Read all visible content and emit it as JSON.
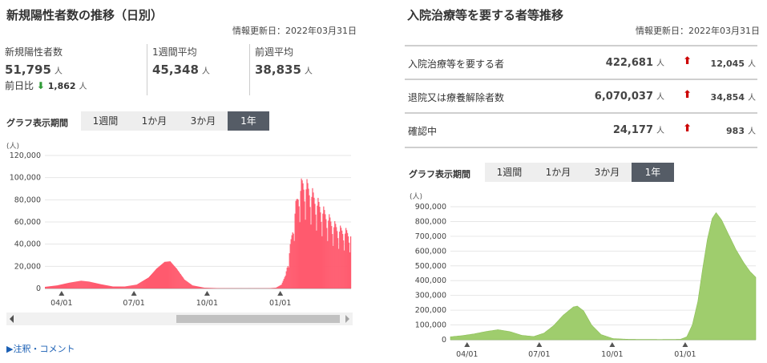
{
  "left": {
    "title": "新規陽性者数の推移（日別）",
    "updated": "情報更新日：2022年03月31日",
    "stats": [
      {
        "label": "新規陽性者数",
        "value": "51,795",
        "unit": "人"
      },
      {
        "label": "1週間平均",
        "value": "45,348",
        "unit": "人"
      },
      {
        "label": "前週平均",
        "value": "38,835",
        "unit": "人"
      }
    ],
    "prev_day": {
      "label": "前日比",
      "arrow": "⬇",
      "value": "1,862",
      "unit": "人",
      "arrow_color": "#2e9a35"
    },
    "period_label": "グラフ表示期間",
    "periods": [
      "1週間",
      "1か月",
      "3か月",
      "1年"
    ],
    "active_period": "1年",
    "note_link": "▶注釈・コメント"
  },
  "right": {
    "title": "入院治療等を要する者等推移",
    "updated": "情報更新日：2022年03月31日",
    "rows": [
      {
        "label": "入院治療等を要する者",
        "value": "422,681",
        "unit": "人",
        "arrow": "⬆",
        "delta": "12,045",
        "delta_unit": "人"
      },
      {
        "label": "退院又は療養解除者数",
        "value": "6,070,037",
        "unit": "人",
        "arrow": "⬆",
        "delta": "34,854",
        "delta_unit": "人"
      },
      {
        "label": "確認中",
        "value": "24,177",
        "unit": "人",
        "arrow": "⬆",
        "delta": "983",
        "delta_unit": "人"
      }
    ],
    "period_label": "グラフ表示期間",
    "periods": [
      "1週間",
      "1か月",
      "3か月",
      "1年"
    ],
    "active_period": "1年"
  },
  "chart_data": [
    {
      "type": "bar",
      "color": "#ff5a6e",
      "unit_label": "(人)",
      "ylim": [
        0,
        120000
      ],
      "yticks": [
        0,
        20000,
        40000,
        60000,
        80000,
        100000,
        120000
      ],
      "ytick_labels": [
        "0",
        "20,000",
        "40,000",
        "60,000",
        "80,000",
        "100,000",
        "120,000"
      ],
      "xtick_labels": [
        "04/01",
        "07/01",
        "10/01",
        "01/01"
      ],
      "xtick_days": [
        21,
        112,
        204,
        296
      ],
      "days": 385,
      "envelope": [
        [
          0,
          1500
        ],
        [
          15,
          2800
        ],
        [
          30,
          5200
        ],
        [
          45,
          7000
        ],
        [
          55,
          6200
        ],
        [
          70,
          3800
        ],
        [
          85,
          1800
        ],
        [
          100,
          1800
        ],
        [
          115,
          3500
        ],
        [
          130,
          10000
        ],
        [
          140,
          18000
        ],
        [
          150,
          24000
        ],
        [
          157,
          24500
        ],
        [
          165,
          18000
        ],
        [
          175,
          8000
        ],
        [
          185,
          2800
        ],
        [
          200,
          700
        ],
        [
          220,
          250
        ],
        [
          250,
          150
        ],
        [
          280,
          200
        ],
        [
          290,
          700
        ],
        [
          297,
          3500
        ],
        [
          302,
          12000
        ],
        [
          308,
          40000
        ],
        [
          314,
          75000
        ],
        [
          319,
          95000
        ],
        [
          324,
          102000
        ],
        [
          330,
          98000
        ],
        [
          338,
          88000
        ],
        [
          346,
          78000
        ],
        [
          354,
          70000
        ],
        [
          362,
          62000
        ],
        [
          370,
          57000
        ],
        [
          377,
          55000
        ],
        [
          385,
          51795
        ]
      ]
    },
    {
      "type": "area",
      "color": "#9fcd6d",
      "unit_label": "(人)",
      "ylim": [
        0,
        900000
      ],
      "yticks": [
        0,
        100000,
        200000,
        300000,
        400000,
        500000,
        600000,
        700000,
        800000,
        900000
      ],
      "ytick_labels": [
        "0",
        "100,000",
        "200,000",
        "300,000",
        "400,000",
        "500,000",
        "600,000",
        "700,000",
        "800,000",
        "900,000"
      ],
      "xtick_labels": [
        "04/01",
        "07/01",
        "10/01",
        "01/01"
      ],
      "xtick_days": [
        21,
        112,
        204,
        296
      ],
      "days": 385,
      "envelope": [
        [
          0,
          20000
        ],
        [
          15,
          28000
        ],
        [
          30,
          40000
        ],
        [
          45,
          56000
        ],
        [
          60,
          68000
        ],
        [
          75,
          55000
        ],
        [
          90,
          30000
        ],
        [
          105,
          22000
        ],
        [
          118,
          45000
        ],
        [
          130,
          95000
        ],
        [
          142,
          165000
        ],
        [
          155,
          222000
        ],
        [
          160,
          228000
        ],
        [
          168,
          195000
        ],
        [
          178,
          100000
        ],
        [
          190,
          35000
        ],
        [
          205,
          8000
        ],
        [
          225,
          3000
        ],
        [
          265,
          2000
        ],
        [
          290,
          3000
        ],
        [
          298,
          20000
        ],
        [
          305,
          100000
        ],
        [
          312,
          260000
        ],
        [
          318,
          480000
        ],
        [
          324,
          680000
        ],
        [
          330,
          820000
        ],
        [
          335,
          860000
        ],
        [
          342,
          810000
        ],
        [
          350,
          720000
        ],
        [
          360,
          610000
        ],
        [
          370,
          520000
        ],
        [
          378,
          460000
        ],
        [
          385,
          422681
        ]
      ]
    }
  ]
}
